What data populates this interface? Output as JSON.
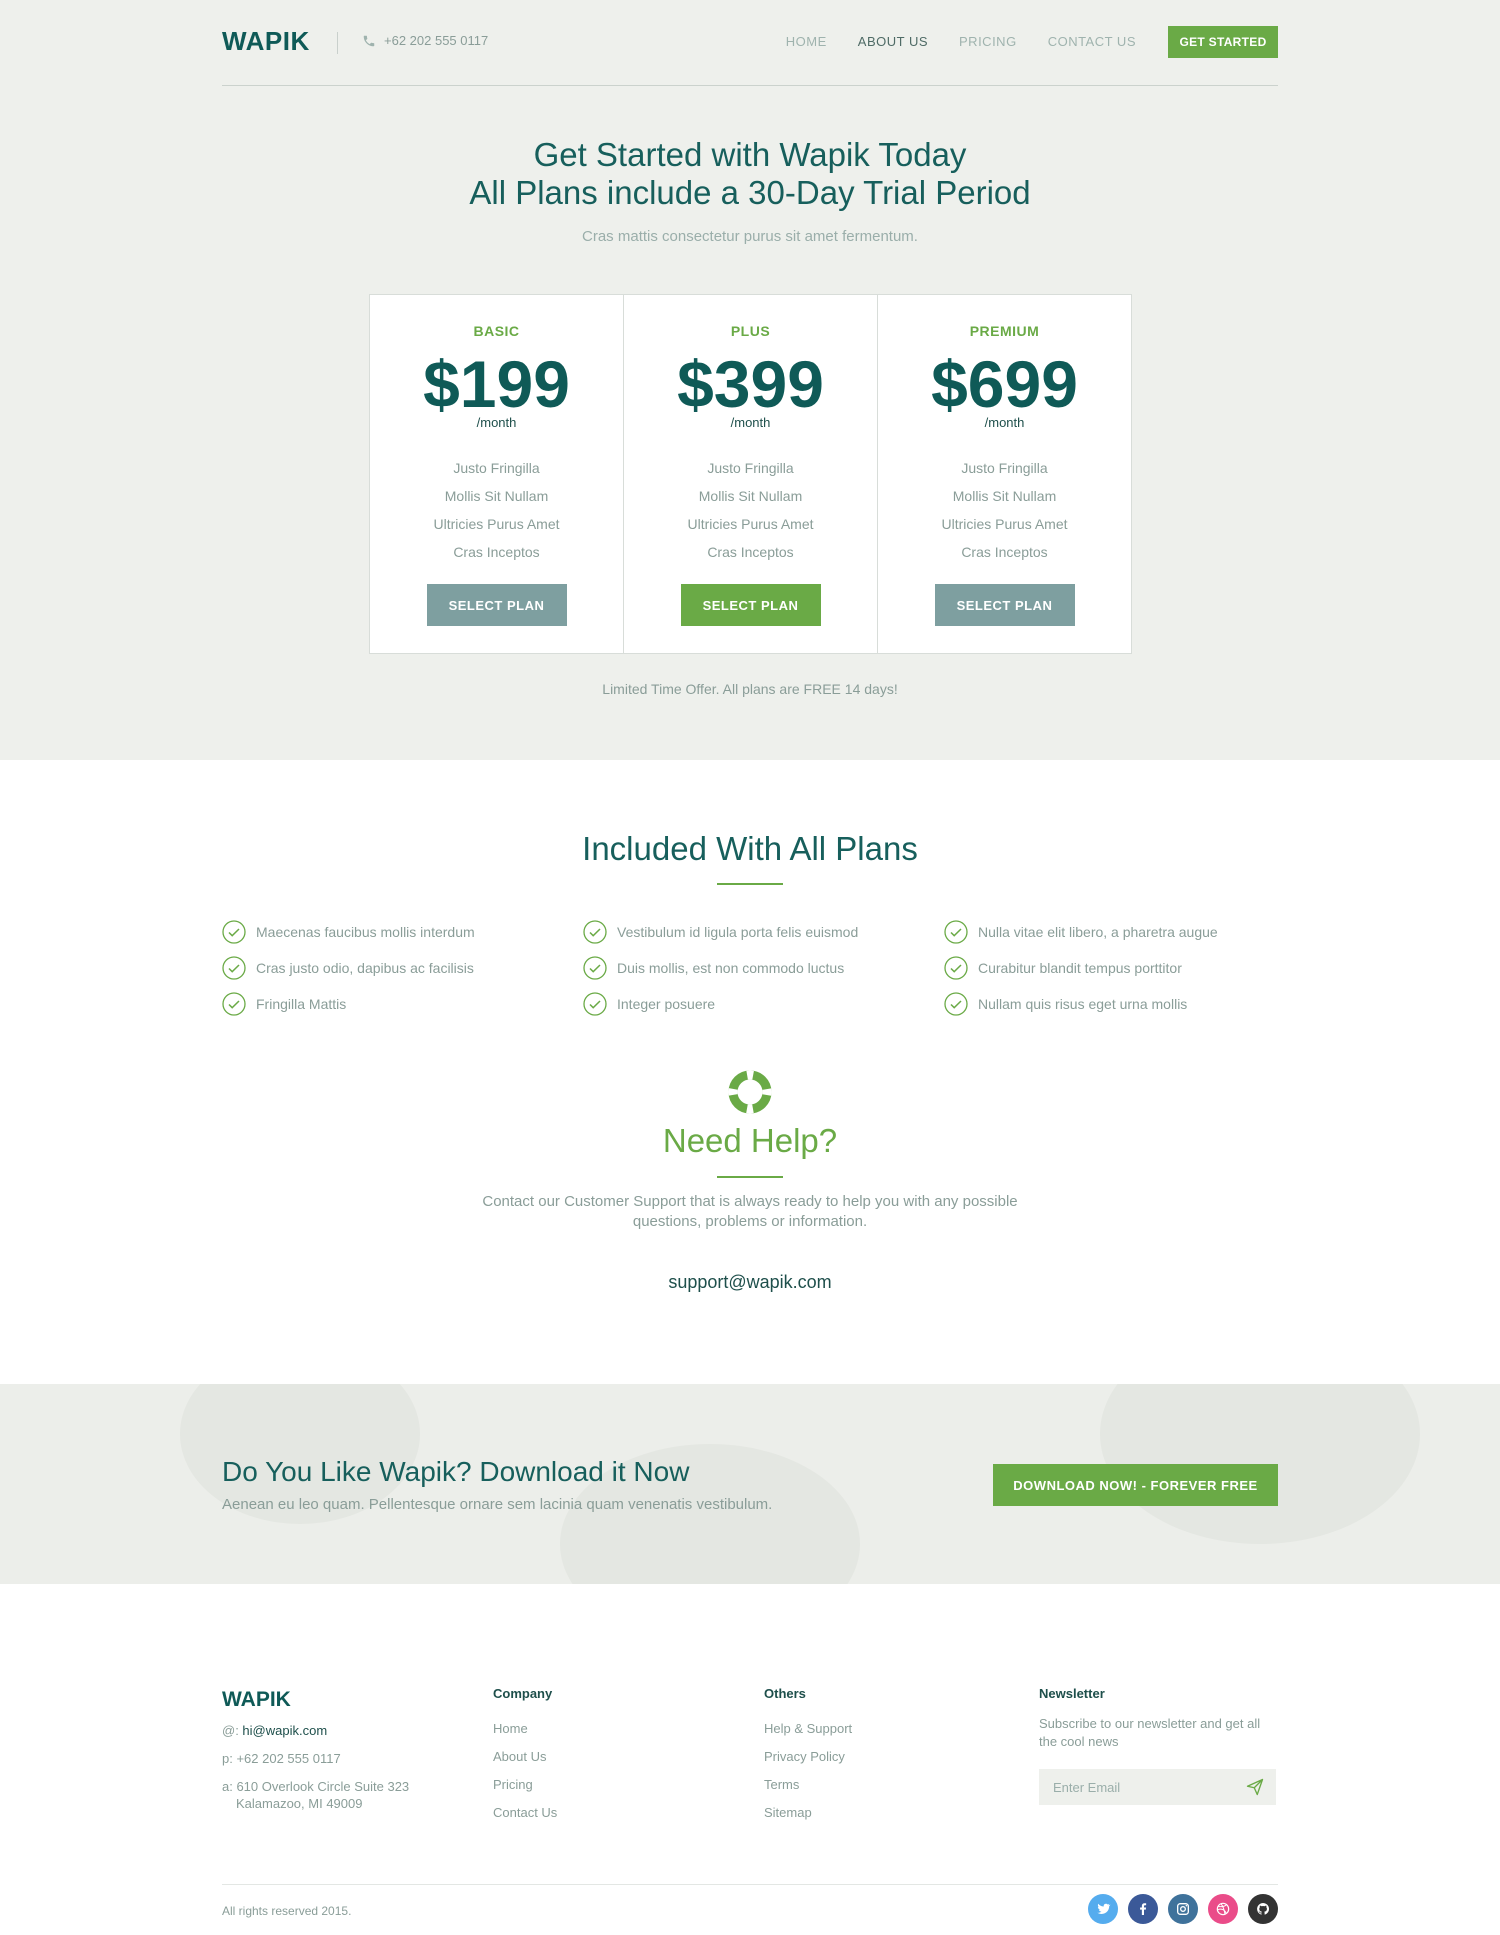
{
  "header": {
    "logo": "WAPIK",
    "phone": "+62 202 555 0117",
    "nav": [
      "HOME",
      "ABOUT US",
      "PRICING",
      "CONTACT US"
    ],
    "cta": "GET STARTED"
  },
  "hero": {
    "title_line1": "Get Started with Wapik Today",
    "title_line2": "All Plans include a 30-Day Trial Period",
    "subtitle": "Cras mattis consectetur purus sit amet fermentum."
  },
  "plans": [
    {
      "name": "BASIC",
      "price": "$199",
      "period": "/month",
      "features": [
        "Justo Fringilla",
        "Mollis Sit Nullam",
        "Ultricies Purus Amet",
        "Cras Inceptos"
      ],
      "button": "SELECT PLAN"
    },
    {
      "name": "PLUS",
      "price": "$399",
      "period": "/month",
      "features": [
        "Justo Fringilla",
        "Mollis Sit Nullam",
        "Ultricies Purus Amet",
        "Cras Inceptos"
      ],
      "button": "SELECT PLAN"
    },
    {
      "name": "PREMIUM",
      "price": "$699",
      "period": "/month",
      "features": [
        "Justo Fringilla",
        "Mollis Sit Nullam",
        "Ultricies Purus Amet",
        "Cras Inceptos"
      ],
      "button": "SELECT PLAN"
    }
  ],
  "offer": "Limited Time Offer. All plans are FREE 14 days!",
  "included": {
    "title": "Included With All Plans",
    "items": [
      "Maecenas faucibus mollis interdum",
      "Vestibulum id ligula porta felis euismod",
      "Nulla vitae elit libero, a pharetra augue",
      "Cras justo odio, dapibus ac facilisis",
      "Duis mollis, est non commodo luctus",
      "Curabitur blandit tempus porttitor",
      "Fringilla Mattis",
      "Integer posuere",
      "Nullam quis risus eget urna mollis"
    ]
  },
  "help": {
    "title": "Need Help?",
    "text": "Contact our Customer Support that is always ready to help you with any possible questions, problems or information.",
    "email": "support@wapik.com"
  },
  "banner": {
    "title": "Do You Like Wapik? Download it Now",
    "subtitle": "Aenean eu leo quam. Pellentesque ornare sem lacinia quam venenatis vestibulum.",
    "button": "DOWNLOAD NOW! - FOREVER FREE"
  },
  "footer": {
    "logo": "WAPIK",
    "email_label": "@: ",
    "email": "hi@wapik.com",
    "phone": "p: +62 202 555 0117",
    "address1": "a: 610 Overlook Circle Suite 323",
    "address2": "Kalamazoo, MI 49009",
    "company_head": "Company",
    "company_links": [
      "Home",
      "About Us",
      "Pricing",
      "Contact Us"
    ],
    "others_head": "Others",
    "others_links": [
      "Help & Support",
      "Privacy Policy",
      "Terms",
      "Sitemap"
    ],
    "newsletter_head": "Newsletter",
    "newsletter_text": "Subscribe to our newsletter and get all the cool news",
    "newsletter_placeholder": "Enter Email",
    "copyright": "All rights reserved 2015.",
    "socials": [
      "twitter-icon",
      "facebook-icon",
      "instagram-icon",
      "dribbble-icon",
      "github-icon"
    ]
  },
  "colors": {
    "brand_dark": "#0f5a57",
    "accent_green": "#6aaa46",
    "button_gray": "#7e9fa0",
    "twitter": "#55acee",
    "facebook": "#3b5998",
    "instagram": "#3f729b",
    "dribbble": "#ea4c89",
    "github": "#333333"
  }
}
